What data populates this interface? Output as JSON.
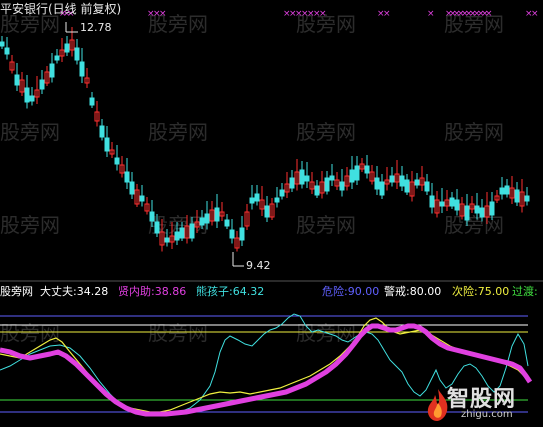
{
  "window": {
    "title": "平安银行(日线 前复权)"
  },
  "price_panel": {
    "high_label": "12.78",
    "low_label": "9.42"
  },
  "indicator_panel": {
    "legend": [
      {
        "label": "股旁网",
        "value": "",
        "color": "#ffffff"
      },
      {
        "label": "大丈夫:",
        "value": "34.28",
        "color": "#ffffff"
      },
      {
        "label": "贤内助:",
        "value": "38.86",
        "color": "#e040e0"
      },
      {
        "label": "熊孩子:",
        "value": "64.32",
        "color": "#40e0e0"
      },
      {
        "label": "危险:",
        "value": "90.00",
        "color": "#6060ff"
      },
      {
        "label": "警戒:",
        "value": "80.00",
        "color": "#ffffff"
      },
      {
        "label": "次险:",
        "value": "75.00",
        "color": "#f0f040"
      },
      {
        "label": "过渡:",
        "value": "",
        "color": "#40e040"
      }
    ]
  },
  "watermark": {
    "text": "股旁网"
  },
  "logo": {
    "name": "智股网",
    "url": "zhigu.com"
  },
  "colors": {
    "background": "#000000",
    "up_candle": "#ff3030",
    "down_candle": "#40e0e0",
    "signal_marker": "#e040e0"
  }
}
